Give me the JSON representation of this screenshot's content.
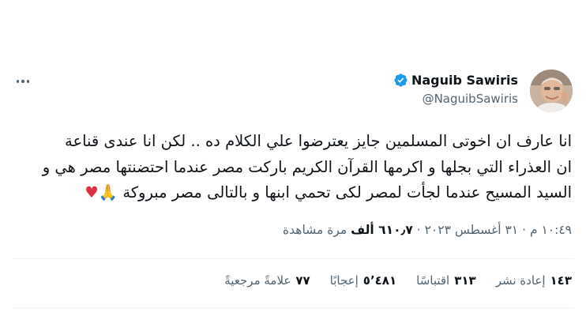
{
  "author": {
    "name": "Naguib Sawiris",
    "handle": "@NaguibSawiris"
  },
  "tweet": {
    "line1": "انا عارف ان اخوتى المسلمين جايز يعترضوا علي الكلام ده .. لكن انا عندى قناعة",
    "line2": "ان العذراء التي بجلها و اكرمها القرآن الكريم باركت مصر عندما احتضنتها مصر هي و",
    "line3": "السيد المسيح عندما لجأت لمصر لكى تحمي ابنها و بالتالى مصر مبروكة",
    "emoji_pray": "🙏",
    "emoji_heart": "♥"
  },
  "meta": {
    "time": "١٠:٤٩ م",
    "date": "٣١ أغسطس ٢٠٢٣",
    "views_count": "٦١٠٫٧ ألف",
    "views_label": "مرة مشاهدة"
  },
  "stats": [
    {
      "count": "١٤٣",
      "label": "إعادة نشر"
    },
    {
      "count": "٣١٣",
      "label": "اقتباسًا"
    },
    {
      "count": "٥٬٤٨١",
      "label": "إعجابًا"
    },
    {
      "count": "٧٧",
      "label": "علامةً مرجعيةً"
    }
  ],
  "colors": {
    "text": "#0f1419",
    "secondary": "#536471",
    "verified_blue": "#1d9bf0",
    "divider": "#eff3f4"
  },
  "icons": {
    "more": "more-horizontal-icon",
    "verified": "verified-badge-icon"
  }
}
